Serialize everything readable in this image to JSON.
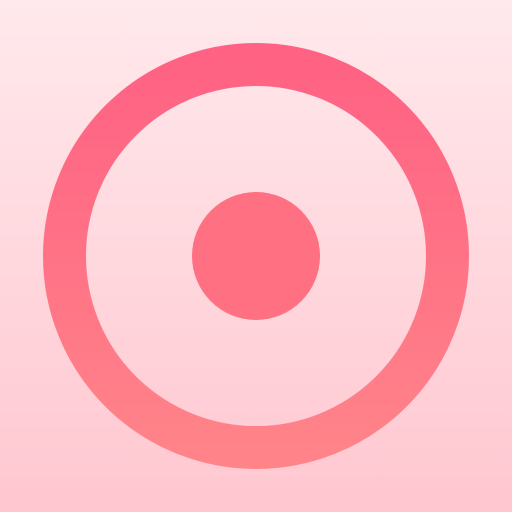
{
  "icon": {
    "name": "record-icon",
    "colors": {
      "background_top": "#ffe9ec",
      "background_bottom": "#ffc7d0",
      "ring_top": "#ff6283",
      "ring_bottom": "#ff8389",
      "dot": "#ff7082"
    }
  }
}
